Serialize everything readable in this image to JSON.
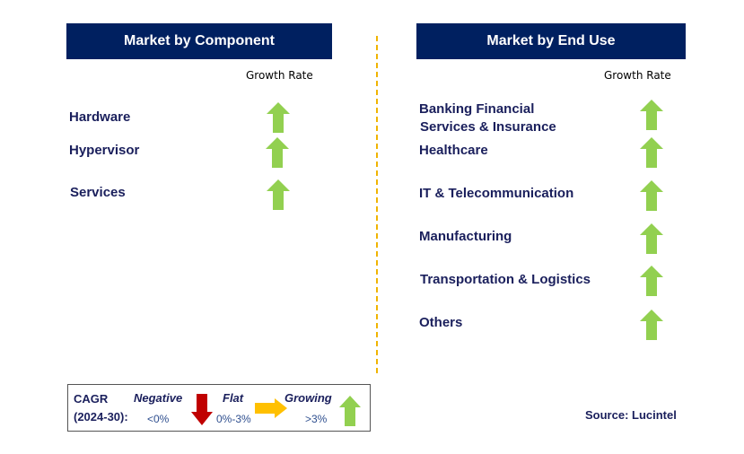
{
  "colors": {
    "header_bg": "#002060",
    "growing": "#92D050",
    "negative": "#C00000",
    "flat": "#FFC000",
    "divider": "#F0B400"
  },
  "left": {
    "title": "Market by Component",
    "growth_rate_label": "Growth Rate",
    "items": [
      {
        "label": "Hardware",
        "growth": "growing"
      },
      {
        "label": "Hypervisor",
        "growth": "growing"
      },
      {
        "label": "Services",
        "growth": "growing"
      }
    ]
  },
  "right": {
    "title": "Market by End Use",
    "growth_rate_label": "Growth Rate",
    "items": [
      {
        "label": "Banking Financial",
        "label2": "Services & Insurance",
        "growth": "growing"
      },
      {
        "label": "Healthcare",
        "growth": "growing"
      },
      {
        "label": "IT & Telecommunication",
        "growth": "growing"
      },
      {
        "label": "Manufacturing",
        "growth": "growing"
      },
      {
        "label": "Transportation & Logistics",
        "growth": "growing"
      },
      {
        "label": "Others",
        "growth": "growing"
      }
    ]
  },
  "legend": {
    "cagr": "CAGR",
    "period": "(2024-30):",
    "negative": "Negative",
    "negative_range": "<0%",
    "flat": "Flat",
    "flat_range": "0%-3%",
    "growing": "Growing",
    "growing_range": ">3%"
  },
  "source": "Source: Lucintel"
}
